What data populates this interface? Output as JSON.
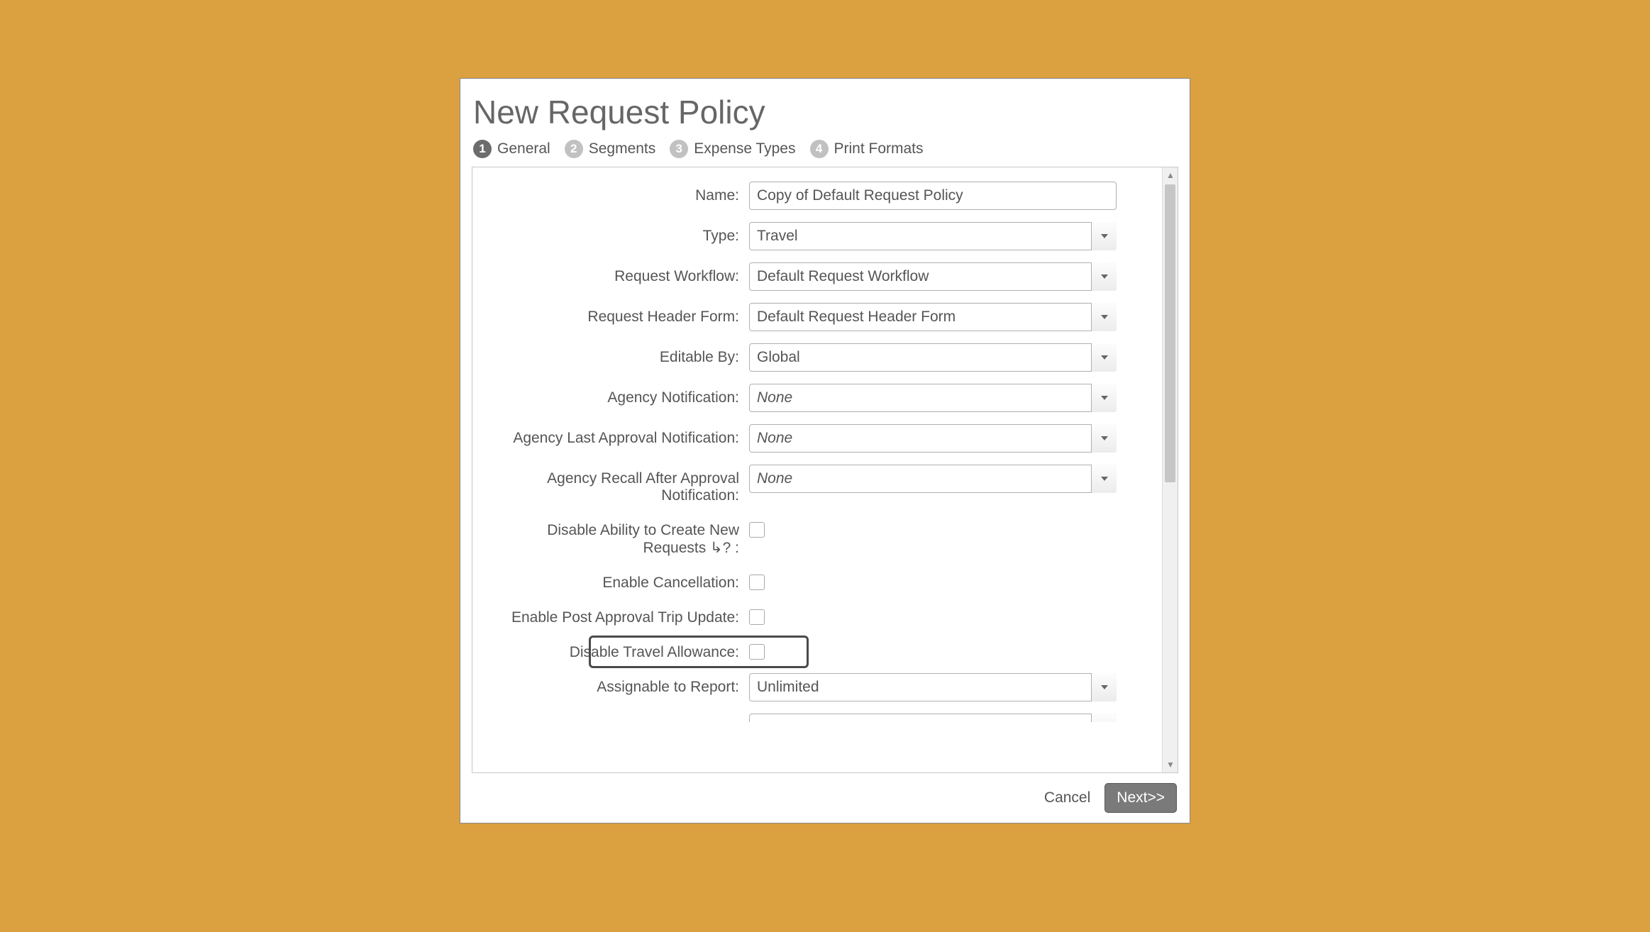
{
  "dialog": {
    "title": "New Request Policy"
  },
  "wizard": {
    "steps": [
      {
        "num": "1",
        "label": "General"
      },
      {
        "num": "2",
        "label": "Segments"
      },
      {
        "num": "3",
        "label": "Expense Types"
      },
      {
        "num": "4",
        "label": "Print Formats"
      }
    ]
  },
  "form": {
    "name_label": "Name:",
    "name_value": "Copy of Default Request Policy",
    "type_label": "Type:",
    "type_value": "Travel",
    "workflow_label": "Request Workflow:",
    "workflow_value": "Default Request Workflow",
    "header_form_label": "Request Header Form:",
    "header_form_value": "Default Request Header Form",
    "editable_by_label": "Editable By:",
    "editable_by_value": "Global",
    "agency_notif_label": "Agency Notification:",
    "agency_notif_value": "None",
    "agency_last_approval_label": "Agency Last Approval Notification:",
    "agency_last_approval_value": "None",
    "agency_recall_label": "Agency Recall After Approval Notification:",
    "agency_recall_value": "None",
    "disable_new_requests_label": "Disable Ability to Create New Requests ↳? :",
    "enable_cancellation_label": "Enable Cancellation:",
    "enable_post_approval_label": "Enable Post Approval Trip Update:",
    "disable_travel_allowance_label": "Disable Travel Allowance:",
    "assignable_to_report_label": "Assignable to Report:",
    "assignable_to_report_value": "Unlimited"
  },
  "footer": {
    "cancel_label": "Cancel",
    "next_label": "Next>>"
  }
}
